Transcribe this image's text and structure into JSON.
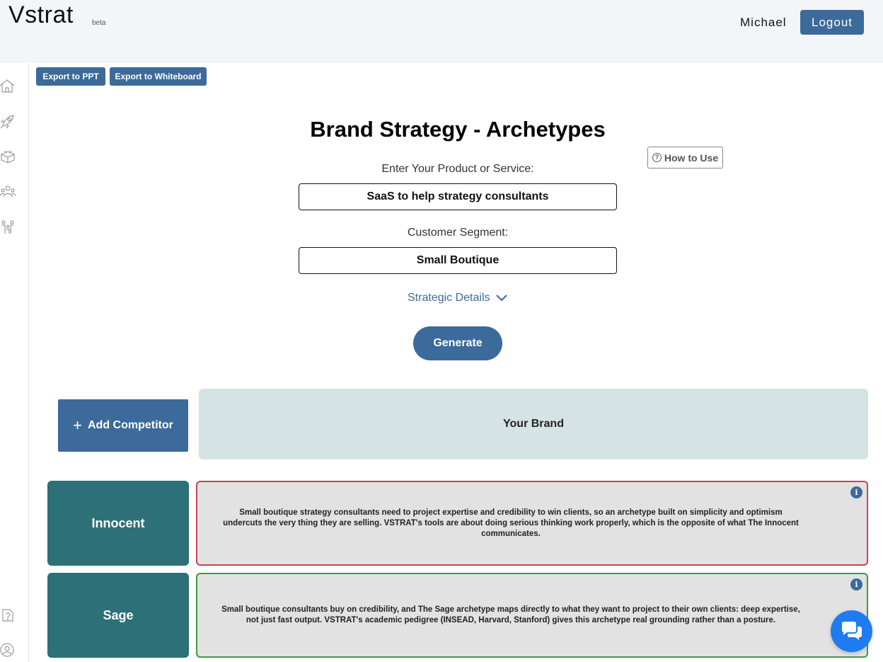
{
  "header": {
    "logo": "Vstrat",
    "beta": "beta",
    "user_name": "Michael",
    "logout_label": "Logout"
  },
  "sidebar": {
    "icons": [
      "home-icon",
      "rocket-icon",
      "box-icon",
      "team-icon",
      "family-icon",
      "help-icon",
      "profile-icon"
    ]
  },
  "toolbar": {
    "export_ppt": "Export to PPT",
    "export_whiteboard": "Export to Whiteboard"
  },
  "main": {
    "title": "Brand Strategy - Archetypes",
    "how_to_use": "How to Use",
    "product_label": "Enter Your Product or Service:",
    "product_value": "SaaS to help strategy consultants",
    "segment_label": "Customer Segment:",
    "segment_value": "Small Boutique",
    "strategic_details": "Strategic Details",
    "generate_label": "Generate"
  },
  "comparison": {
    "add_competitor": "Add Competitor",
    "your_brand": "Your Brand",
    "archetypes": [
      {
        "name": "Innocent",
        "status": "mismatch",
        "border_color": "#c94452",
        "description": "Small boutique strategy consultants need to project expertise and credibility to win clients, so an archetype built on simplicity and optimism undercuts the very thing they are selling. VSTRAT's tools are about doing serious thinking work properly, which is the opposite of what The Innocent communicates."
      },
      {
        "name": "Sage",
        "status": "match",
        "border_color": "#3c9a48",
        "description": "Small boutique consultants buy on credibility, and The Sage archetype maps directly to what they want to project to their own clients: deep expertise, not just fast output. VSTRAT's academic pedigree (INSEAD, Harvard, Stanford) gives this archetype real grounding rather than a posture."
      }
    ]
  },
  "colors": {
    "primary": "#3c6a9a",
    "teal": "#2e7077",
    "brand_bg": "#d6e3e5",
    "chat": "#1e7bf0"
  }
}
